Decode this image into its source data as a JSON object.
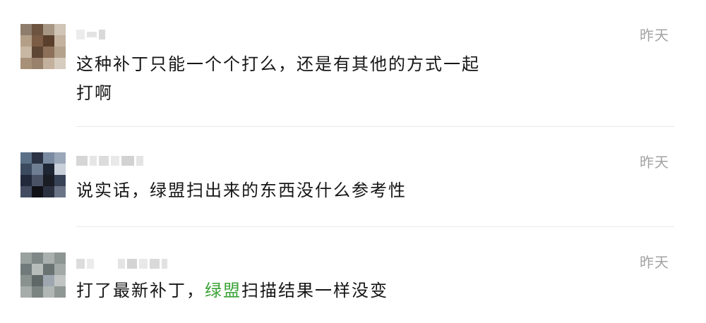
{
  "comments": [
    {
      "time": "昨天",
      "text_before": "这种补丁只能一个个打么，还是有其他的方式一起打啊",
      "highlight": "",
      "text_after": ""
    },
    {
      "time": "昨天",
      "text_before": "说实话，绿盟扫出来的东西没什么参考性",
      "highlight": "",
      "text_after": ""
    },
    {
      "time": "昨天",
      "text_before": "打了最新补丁，",
      "highlight": "绿盟",
      "text_after": "扫描结果一样没变"
    }
  ],
  "colors": {
    "highlight": "#3aa236",
    "time": "#a3a3a3",
    "divider": "#e8e8e8"
  }
}
